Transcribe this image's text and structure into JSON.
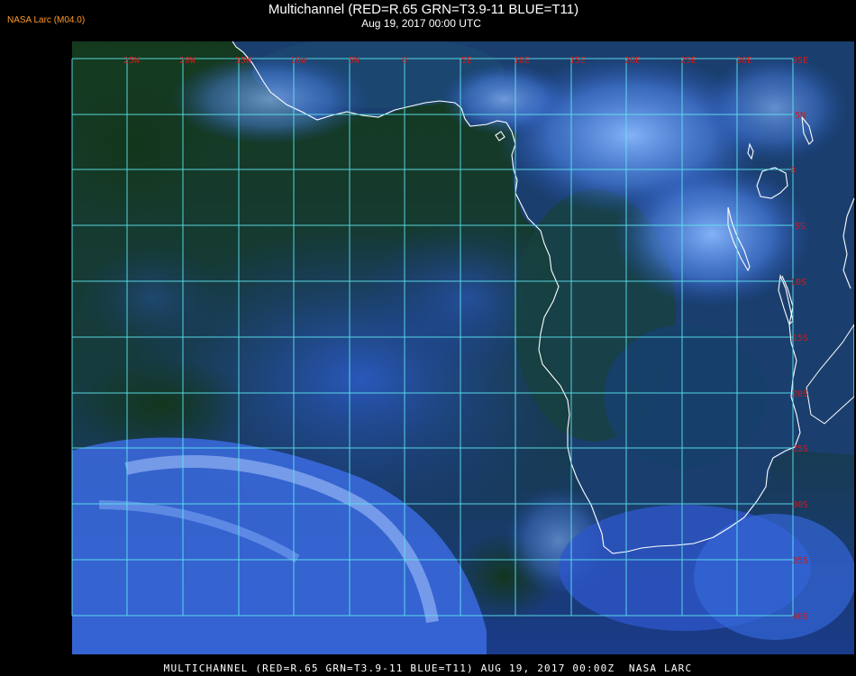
{
  "header": {
    "credit": "NASA Larc (M04.0)",
    "title": "Multichannel (RED=R.65 GRN=T3.9-11 BLUE=T11)",
    "subtitle": "Aug 19, 2017 00:00 UTC"
  },
  "map": {
    "projection_grid_step_degrees": 5,
    "longitude_labels": [
      "25W",
      "20W",
      "15W",
      "10W",
      "5W",
      "0",
      "5E",
      "10E",
      "15E",
      "20E",
      "25E",
      "30E",
      "35E"
    ],
    "latitude_labels": [
      "5N",
      "0",
      "5S",
      "10S",
      "15S",
      "20S",
      "25S",
      "30S",
      "35S",
      "40S"
    ],
    "colors": {
      "ocean_clear": "#13331b",
      "ocean_low_cloud": "#1e3ea8",
      "high_cloud": "#7fb2ff",
      "land": "#173a6d",
      "gridline": "#5ee6f0",
      "label": "#cc1b1b",
      "coastline": "#ffffff"
    }
  },
  "footer": {
    "text": "MULTICHANNEL (RED=R.65 GRN=T3.9-11 BLUE=T11) AUG 19, 2017 00:00Z  NASA LARC"
  }
}
